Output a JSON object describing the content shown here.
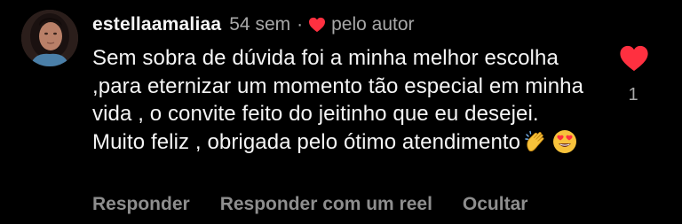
{
  "comment": {
    "username": "estellaamaliaa",
    "time": "54 sem",
    "separator": "·",
    "liked_by_author": "pelo autor",
    "text": "Sem sobra de dúvida foi a minha melhor escolha ,para eternizar um momento tão especial em minha vida , o convite feito do jeitinho que eu desejei. Muito feliz , obrigada pelo ótimo atendimento",
    "emojis": [
      "clapping-hands",
      "heart-eyes"
    ],
    "like_count": "1"
  },
  "actions": {
    "reply": "Responder",
    "reply_with_reel": "Responder com um reel",
    "hide": "Ocultar"
  },
  "colors": {
    "background": "#000000",
    "text": "#f5f5f5",
    "secondary": "#a8a8a8",
    "action": "#8e8e8e",
    "heart": "#ff3040"
  }
}
